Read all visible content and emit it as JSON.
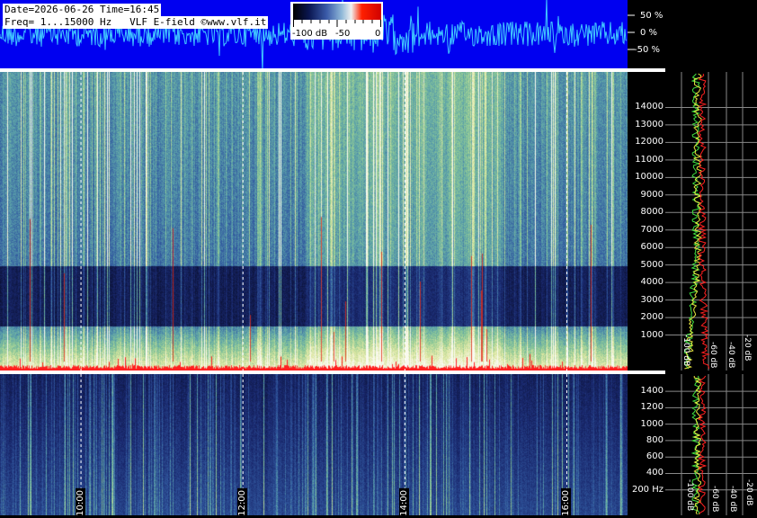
{
  "header": {
    "line1": "Date=2026-06-26 Time=16:45",
    "line2": "Freq= 1...15000 Hz   VLF E-field ©www.vlf.it"
  },
  "colorbar": {
    "labels": [
      "-100 dB",
      "-50",
      "0"
    ],
    "colors": [
      "#000000",
      "#0a1650",
      "#3a5aa8",
      "#8fb8d8",
      "#f0f0f0",
      "#ff2000",
      "#d00000"
    ]
  },
  "waveform": {
    "amplitude_labels": [
      "50 %",
      "0 %",
      "-50 %"
    ],
    "background": "#0000f0",
    "trace_color": "#40c8ff"
  },
  "chart_data": [
    {
      "type": "heatmap",
      "panel": "spectrogram-upper",
      "y_range_hz": [
        1,
        15000
      ],
      "y_ticks": [
        1000,
        2000,
        3000,
        4000,
        5000,
        6000,
        7000,
        8000,
        9000,
        10000,
        11000,
        12000,
        13000,
        14000
      ],
      "y_tick_labels": [
        "1000",
        "2000",
        "3000",
        "4000",
        "5000",
        "6000",
        "7000",
        "8000",
        "9000",
        "10000",
        "11000",
        "12000",
        "13000",
        "14000"
      ],
      "spectrum_db_ticks": [
        "-100 dB",
        "-60 dB",
        "-40 dB",
        "-20 dB"
      ]
    },
    {
      "type": "heatmap",
      "panel": "spectrogram-lower",
      "y_range_hz": [
        0,
        1500
      ],
      "y_ticks": [
        200,
        400,
        600,
        800,
        1000,
        1200,
        1400
      ],
      "y_tick_labels": [
        "200 Hz",
        "400",
        "600",
        "800",
        "1000",
        "1200",
        "1400"
      ],
      "spectrum_db_ticks": [
        "-100 dB",
        "-60 dB",
        "-40 dB",
        "-20 dB"
      ]
    }
  ],
  "time_axis": {
    "tick_labels": [
      "10:00",
      "12:00",
      "14:00",
      "16:00"
    ],
    "start_hour": 9.0,
    "end_hour": 16.75
  },
  "colors": {
    "spectrum_red": "#ff2020",
    "spectrum_yellow": "#e8e840",
    "spectrum_green": "#40e040"
  }
}
